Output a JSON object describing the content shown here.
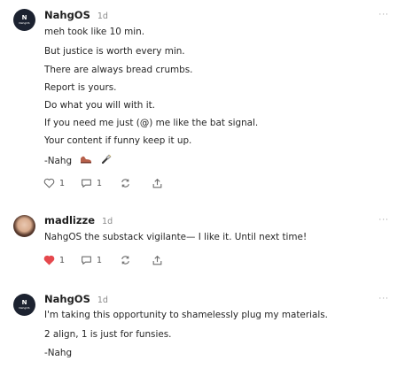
{
  "comments": [
    {
      "author": "NahgOS",
      "time": "1d",
      "avatar_text": "N",
      "avatar_subtext": "NahgOS",
      "lines": [
        "meh took like 10 min.",
        "But justice is worth every min.",
        "There are always bread crumbs.",
        "Report is yours.",
        "Do what you will with it.",
        "If you need me just (@) me like the bat signal.",
        "Your content if funny keep it up.",
        "-Nahg"
      ],
      "like_count": "1",
      "reply_count": "1",
      "liked": false,
      "signature_icons": [
        "shoe-icon",
        "flashlight-icon"
      ]
    },
    {
      "author": "madlizze",
      "time": "1d",
      "lines": [
        "NahgOS the substack vigilante— I like it. Until next time!"
      ],
      "like_count": "1",
      "reply_count": "1",
      "liked": true
    },
    {
      "author": "NahgOS",
      "time": "1d",
      "avatar_text": "N",
      "avatar_subtext": "NahgOS",
      "lines": [
        "I'm taking this opportunity to shamelessly plug my materials.",
        "2 align, 1 is just for funsies.",
        "-Nahg"
      ]
    }
  ],
  "more_menu_label": "···",
  "colors": {
    "like_active": "#e5484d",
    "icon_gray": "#6b6b6b",
    "avatar_dark": "#1c2230"
  }
}
